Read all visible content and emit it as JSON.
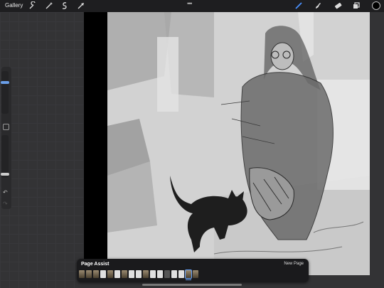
{
  "topbar": {
    "gallery_label": "Gallery",
    "left_tools": [
      "wrench-icon",
      "magic-wand-icon",
      "selection-icon",
      "transform-arrow-icon"
    ],
    "more_dots": "•••",
    "right_tools": [
      "brush-icon",
      "smudge-icon",
      "eraser-icon",
      "layers-icon",
      "color-icon"
    ],
    "active_tool": "brush",
    "active_color": "#000000",
    "accent": "#4a90ff"
  },
  "sidebar": {
    "brush_size_level": 0.75,
    "opacity_level": 0.05,
    "undo_icon": "↶",
    "redo_icon": "↷"
  },
  "page_assist": {
    "title": "Page Assist",
    "new_page_label": "New Page",
    "thumbnails": [
      "img",
      "img",
      "img",
      "blank",
      "img",
      "blank",
      "img",
      "blank",
      "blank",
      "img",
      "blank",
      "blank",
      "dark",
      "blank",
      "blank",
      "img",
      "img"
    ],
    "selected_index": 15
  }
}
